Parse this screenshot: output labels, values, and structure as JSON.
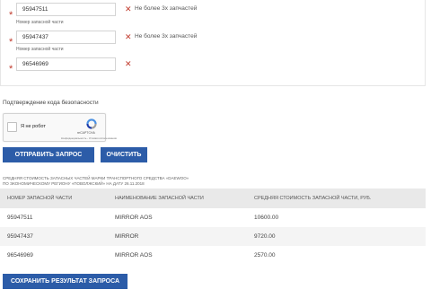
{
  "parts": {
    "rows": [
      {
        "label": "",
        "value": "95947511",
        "error": "Не более 3х запчастей"
      },
      {
        "label": "Номер запасной части",
        "value": "95947437",
        "error": "Не более 3х запчастей"
      },
      {
        "label": "Номер запасной части",
        "value": "96546969",
        "error": ""
      }
    ],
    "required_marker": "*",
    "remove_glyph": "✕"
  },
  "captcha": {
    "title": "Подтверждение кода безопасности",
    "checkbox_label": "Я не робот",
    "brand": "reCAPTCHA",
    "terms": "Конфиденциальность - Условия использования"
  },
  "buttons": {
    "submit": "ОТПРАВИТЬ ЗАПРОС",
    "clear": "ОЧИСТИТЬ",
    "save": "СОХРАНИТЬ РЕЗУЛЬТАТ ЗАПРОСА"
  },
  "results": {
    "caption_line1": "СРЕДНЯЯ СТОИМОСТЬ ЗАПАСНЫХ ЧАСТЕЙ МАРКИ ТРАНСПОРТНОГО СРЕДСТВА «DAEWOO»",
    "caption_line2": "ПО ЭКОНОМИЧЕСКОМУ РЕГИОНУ «ПОВОЛЖСКИЙ» НА ДАТУ 26.11.2018",
    "headers": [
      "НОМЕР ЗАПАСНОЙ ЧАСТИ",
      "НАИМЕНОВАНИЕ ЗАПАСНОЙ ЧАСТИ",
      "СРЕДНЯЯ СТОИМОСТЬ ЗАПАСНОЙ ЧАСТИ, РУБ."
    ],
    "rows": [
      [
        "95947511",
        "MIRROR AOS",
        "10600.00"
      ],
      [
        "95947437",
        "MIRROR",
        "9720.00"
      ],
      [
        "96546969",
        "MIRROR AOS",
        "2570.00"
      ]
    ]
  },
  "colors": {
    "accent": "#2c5ca8",
    "error": "#c0392b",
    "table_header": "#e9e9e9"
  }
}
